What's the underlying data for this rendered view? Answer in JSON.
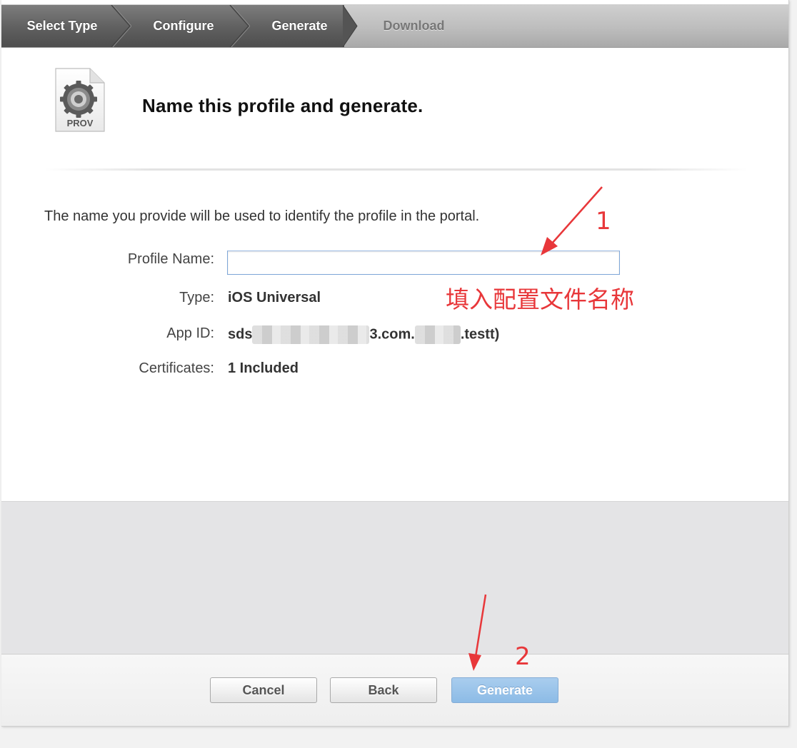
{
  "steps": [
    {
      "label": "Select Type",
      "state": "done"
    },
    {
      "label": "Configure",
      "state": "done"
    },
    {
      "label": "Generate",
      "state": "current"
    },
    {
      "label": "Download",
      "state": "upcoming"
    }
  ],
  "header": {
    "icon_label": "PROV",
    "title": "Name this profile and generate."
  },
  "description": "The name you provide will be used to identify the profile in the portal.",
  "form": {
    "profile_name_label": "Profile Name:",
    "profile_name_value": "",
    "type_label": "Type:",
    "type_value": "iOS Universal",
    "app_id_label": "App ID:",
    "app_id_prefix": "sds",
    "app_id_mid": "3.com.",
    "app_id_suffix": ".testt)",
    "certificates_label": "Certificates:",
    "certificates_value": "1 Included"
  },
  "annotations": {
    "step1_number": "1",
    "step1_text": "填入配置文件名称",
    "step2_number": "2",
    "color": "#e8373a"
  },
  "buttons": {
    "cancel": "Cancel",
    "back": "Back",
    "generate": "Generate"
  }
}
